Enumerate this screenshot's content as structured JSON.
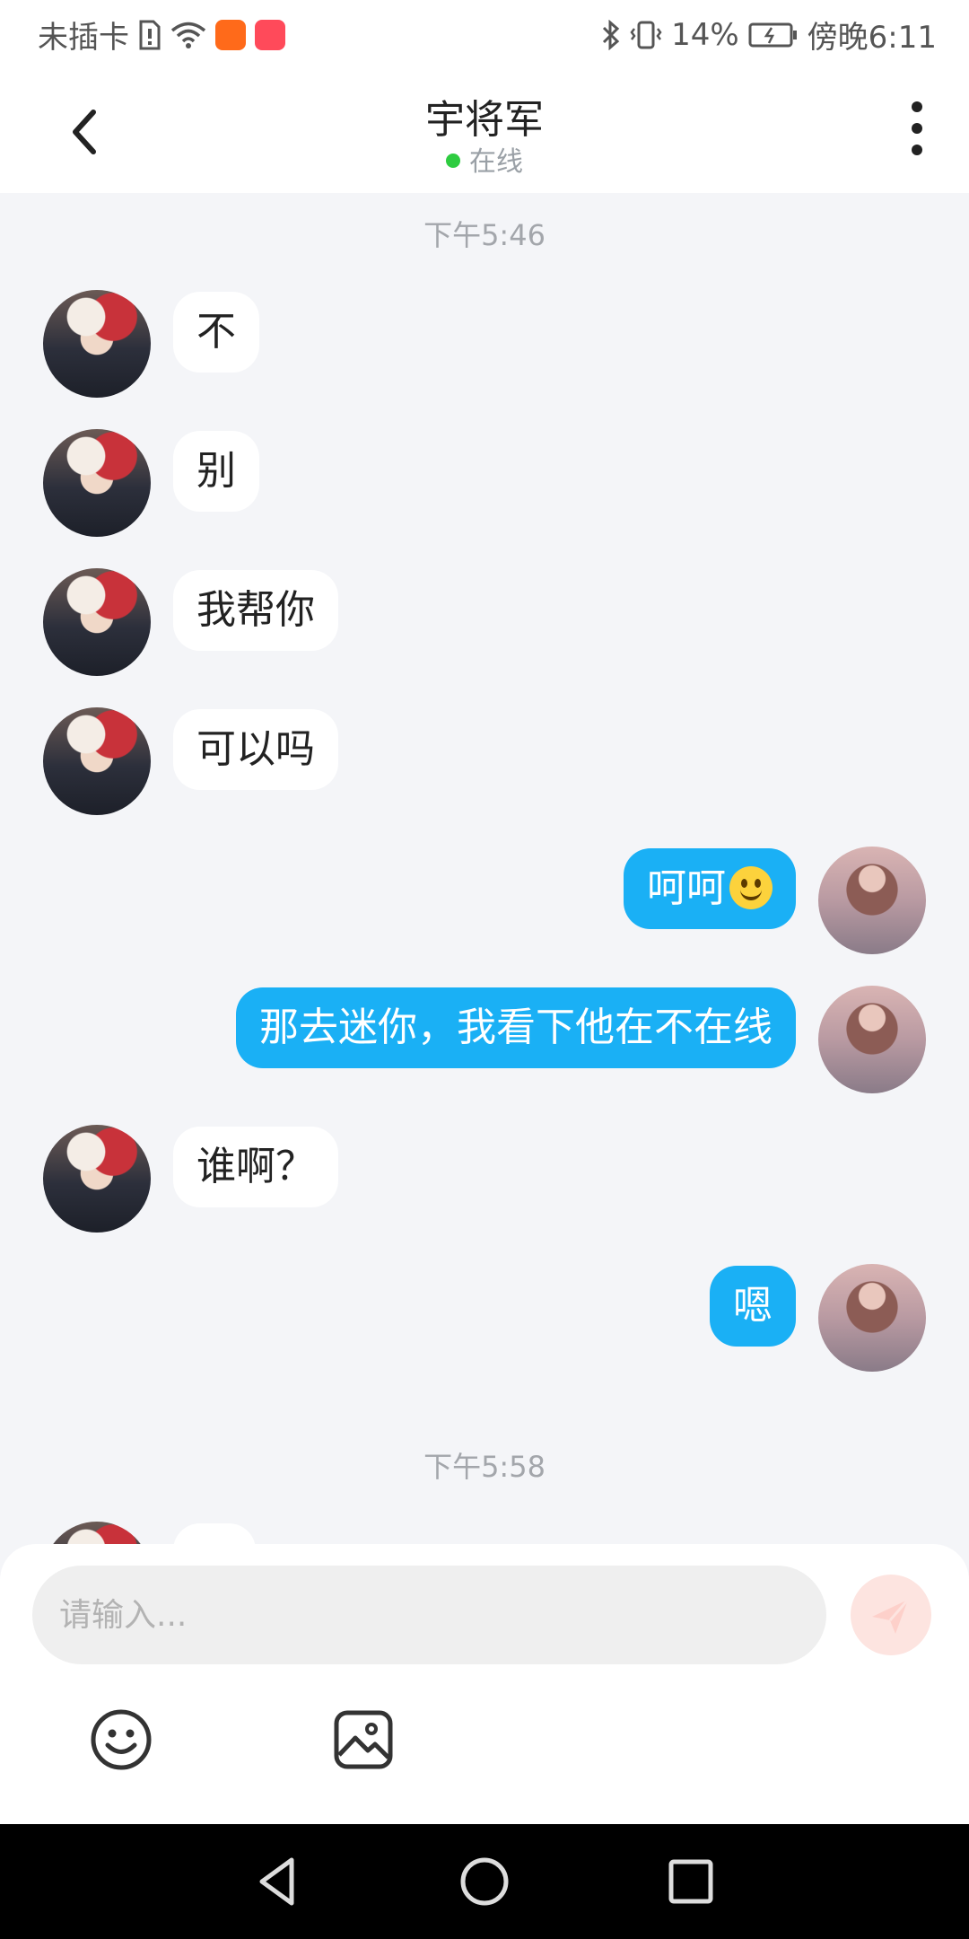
{
  "status_bar": {
    "carrier": "未插卡",
    "battery": "14%",
    "time": "傍晚6:11"
  },
  "header": {
    "title": "宇将军",
    "presence": "在线"
  },
  "chat": {
    "timestamps": [
      "下午5:46",
      "下午5:58"
    ],
    "messages": [
      {
        "side": "in",
        "text": "不"
      },
      {
        "side": "in",
        "text": "别"
      },
      {
        "side": "in",
        "text": "我帮你"
      },
      {
        "side": "in",
        "text": "可以吗"
      },
      {
        "side": "out",
        "text": "呵呵",
        "emoji": "smiley"
      },
      {
        "side": "out",
        "text": "那去迷你，我看下他在不在线"
      },
      {
        "side": "in",
        "text": "谁啊？"
      },
      {
        "side": "out",
        "text": "嗯"
      }
    ]
  },
  "input": {
    "placeholder": "请输入..."
  },
  "colors": {
    "outgoing_bubble": "#1ab0f5",
    "incoming_bubble": "#ffffff",
    "online_dot": "#2ecc40",
    "send_button": "#fde4e0"
  },
  "icons": {
    "back": "chevron-left-icon",
    "more": "more-vertical-icon",
    "send": "paper-plane-icon",
    "emoji": "emoji-icon",
    "image": "image-icon"
  }
}
